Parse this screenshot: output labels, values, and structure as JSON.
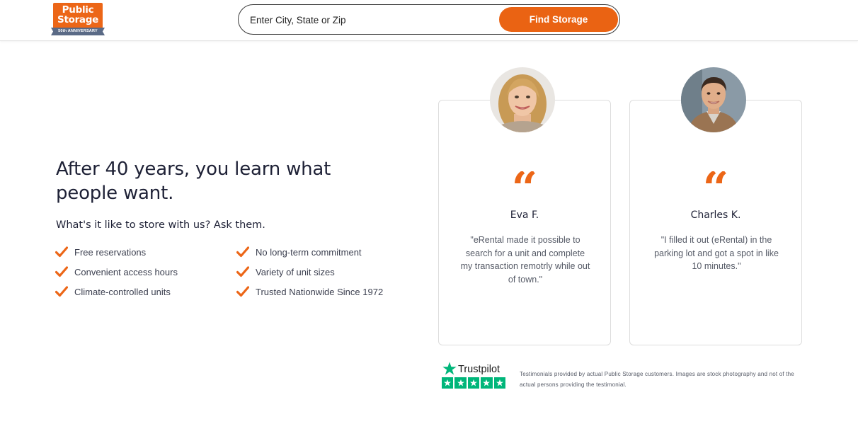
{
  "brand": {
    "logo_line1": "Public",
    "logo_line2": "Storage",
    "logo_ribbon": "50th ANNIVERSARY",
    "accent_color": "#ec6617",
    "ribbon_color": "#5a6a86"
  },
  "search": {
    "placeholder": "Enter City, State or Zip",
    "value": "",
    "button_label": "Find Storage"
  },
  "hero": {
    "headline": "After 40 years, you learn what people want.",
    "subhead": "What's it like to store with us? Ask them.",
    "features": [
      "Free reservations",
      "No long-term commitment",
      "Convenient access hours",
      "Variety of unit sizes",
      "Climate-controlled units",
      "Trusted Nationwide Since 1972"
    ],
    "check_icon": "checkmark-icon"
  },
  "testimonials": [
    {
      "name": "Eva F.",
      "quote": "\"eRental made it possible to search for a unit and complete my transaction remotrly while out of town.\"",
      "quote_mark": "“",
      "avatar_icon": "woman-portrait"
    },
    {
      "name": "Charles K.",
      "quote": "\"I filled it out (eRental) in the parking lot and got a spot in like 10 minutes.\"",
      "quote_mark": "“",
      "avatar_icon": "man-portrait"
    }
  ],
  "trustpilot": {
    "label": "Trustpilot",
    "stars": 5,
    "star_color": "#00b67a"
  },
  "disclaimer": "Testimonials provided by actual Public Storage customers. Images are stock photography and not of the actual persons providing the testimonial."
}
